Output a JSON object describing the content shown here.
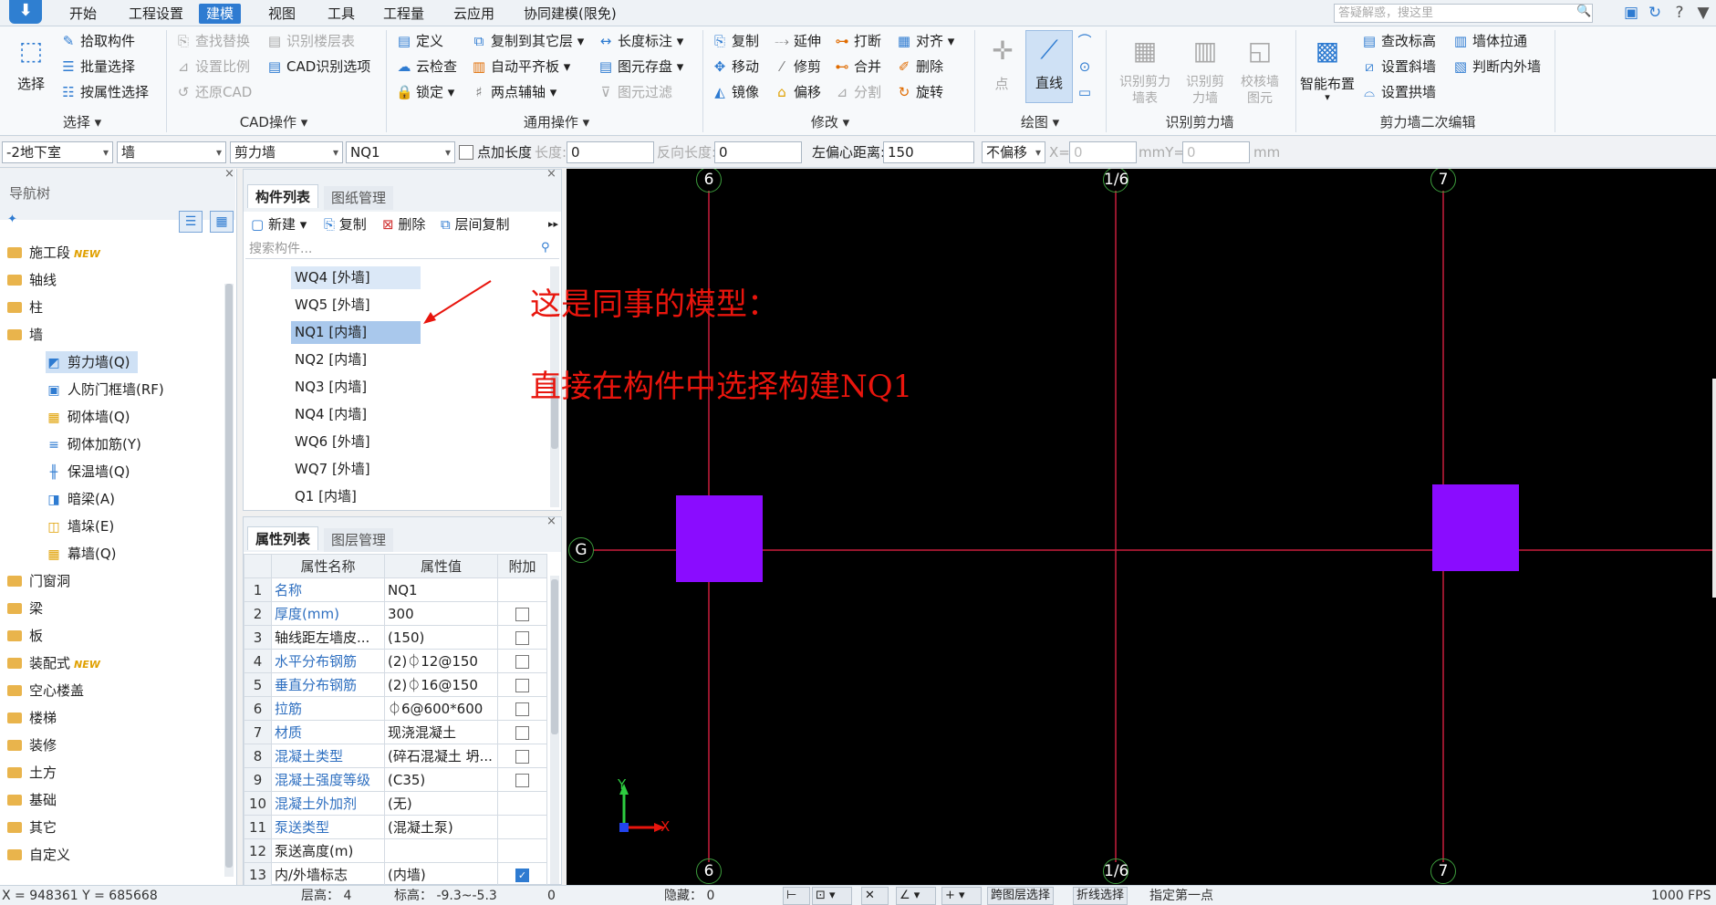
{
  "menubar": {
    "items": [
      "开始",
      "工程设置",
      "建模",
      "视图",
      "工具",
      "工程量",
      "云应用",
      "协同建模(限免)"
    ],
    "active_index": 2,
    "search_placeholder": "答疑解惑，搜这里"
  },
  "ribbon": {
    "select": {
      "big": "选择",
      "items": [
        "拾取构件",
        "批量选择",
        "按属性选择"
      ],
      "group": "选择"
    },
    "cad": {
      "items": [
        "查找替换",
        "设置比例",
        "还原CAD",
        "识别楼层表",
        "CAD识别选项"
      ],
      "group": "CAD操作"
    },
    "common": {
      "items": [
        "定义",
        "云检查",
        "锁定",
        "复制到其它层",
        "自动平齐板",
        "两点辅轴",
        "长度标注",
        "图元存盘",
        "图元过滤"
      ],
      "group": "通用操作"
    },
    "modify": {
      "items": [
        "复制",
        "移动",
        "镜像",
        "延伸",
        "修剪",
        "偏移",
        "打断",
        "合并",
        "分割",
        "对齐",
        "删除",
        "旋转"
      ],
      "group": "修改"
    },
    "draw": {
      "items": [
        "点",
        "直线"
      ],
      "group": "绘图"
    },
    "recognize": {
      "items": [
        "识别剪力墙表",
        "识别剪力墙",
        "校核墙图元"
      ],
      "group": "识别剪力墙"
    },
    "secondary": {
      "big": "智能布置",
      "items": [
        "查改标高",
        "设置斜墙",
        "设置拱墙",
        "墙体拉通",
        "判断内外墙"
      ],
      "group": "剪力墙二次编辑"
    }
  },
  "propbar": {
    "floor": "-2地下室",
    "type": "墙",
    "subtype": "剪力墙",
    "component": "NQ1",
    "point_length_label": "点加长度",
    "length_label": "长度:",
    "length_value": "0",
    "reverse_label": "反向长度:",
    "reverse_value": "0",
    "offset_label": "左偏心距离:",
    "offset_value": "150",
    "shift": "不偏移",
    "x_label": "X=",
    "x_value": "0",
    "mm1": "mmY=",
    "y_value": "0",
    "mm2": "mm"
  },
  "nav": {
    "title": "导航树",
    "items": [
      {
        "label": "施工段",
        "new": "NEW"
      },
      {
        "label": "轴线"
      },
      {
        "label": "柱"
      },
      {
        "label": "墙"
      }
    ],
    "wall_children": [
      "剪力墙(Q)",
      "人防门框墙(RF)",
      "砌体墙(Q)",
      "砌体加筋(Y)",
      "保温墙(Q)",
      "暗梁(A)",
      "墙垛(E)",
      "幕墙(Q)"
    ],
    "items_after": [
      {
        "label": "门窗洞"
      },
      {
        "label": "梁"
      },
      {
        "label": "板"
      },
      {
        "label": "装配式",
        "new": "NEW"
      },
      {
        "label": "空心楼盖"
      },
      {
        "label": "楼梯"
      },
      {
        "label": "装修"
      },
      {
        "label": "土方"
      },
      {
        "label": "基础"
      },
      {
        "label": "其它"
      },
      {
        "label": "自定义"
      }
    ]
  },
  "components": {
    "tabs": [
      "构件列表",
      "图纸管理"
    ],
    "toolbar": [
      "新建",
      "复制",
      "删除",
      "层间复制"
    ],
    "search_placeholder": "搜索构件...",
    "list": [
      "WQ4 [外墙]",
      "WQ5 [外墙]",
      "NQ1 [内墙]",
      "NQ2 [内墙]",
      "NQ3 [内墙]",
      "NQ4 [内墙]",
      "WQ6 [外墙]",
      "WQ7 [外墙]",
      "Q1 [内墙]"
    ]
  },
  "properties": {
    "tabs": [
      "属性列表",
      "图层管理"
    ],
    "headers": [
      "属性名称",
      "属性值",
      "附加"
    ],
    "rows": [
      {
        "n": "1",
        "name": "名称",
        "value": "NQ1",
        "blue": true,
        "check": null
      },
      {
        "n": "2",
        "name": "厚度(mm)",
        "value": "300",
        "blue": true,
        "check": false
      },
      {
        "n": "3",
        "name": "轴线距左墙皮...",
        "value": "(150)",
        "blue": false,
        "check": false
      },
      {
        "n": "4",
        "name": "水平分布钢筋",
        "value": "(2)⏀12@150",
        "blue": true,
        "check": false
      },
      {
        "n": "5",
        "name": "垂直分布钢筋",
        "value": "(2)⏀16@150",
        "blue": true,
        "check": false
      },
      {
        "n": "6",
        "name": "拉筋",
        "value": "⏀6@600*600",
        "blue": true,
        "check": false
      },
      {
        "n": "7",
        "name": "材质",
        "value": "现浇混凝土",
        "blue": true,
        "check": false
      },
      {
        "n": "8",
        "name": "混凝土类型",
        "value": "(碎石混凝土 坍...",
        "blue": true,
        "check": false
      },
      {
        "n": "9",
        "name": "混凝土强度等级",
        "value": "(C35)",
        "blue": true,
        "check": false
      },
      {
        "n": "10",
        "name": "混凝土外加剂",
        "value": "(无)",
        "blue": true,
        "check": null
      },
      {
        "n": "11",
        "name": "泵送类型",
        "value": "(混凝土泵)",
        "blue": true,
        "check": null
      },
      {
        "n": "12",
        "name": "泵送高度(m)",
        "value": "",
        "blue": false,
        "check": null
      },
      {
        "n": "13",
        "name": "内/外墙标志",
        "value": "(内墙)",
        "blue": false,
        "check": true
      }
    ]
  },
  "canvas": {
    "annotation_line1": "这是同事的模型：",
    "annotation_line2": "直接在构件中选择构建NQ1",
    "axes_top": [
      "6",
      "1/6",
      "7"
    ],
    "axes_bottom": [
      "6",
      "1/6",
      "7"
    ],
    "axis_left": "G",
    "y_label": "Y",
    "x_label": "X",
    "column_color": "#8a0cff",
    "grid_color": "#c81e3c",
    "annotation_color": "#e8150d"
  },
  "status": {
    "coords": "X = 948361 Y = 685668",
    "floor_height": "层高：  4",
    "elevation": "标高：  -9.3~-5.3",
    "zero": "0",
    "hidden": "隐藏：  0",
    "cross_layer": "跨图层选择",
    "polyline": "折线选择",
    "hint": "指定第一点",
    "fps": "1000 FPS"
  }
}
